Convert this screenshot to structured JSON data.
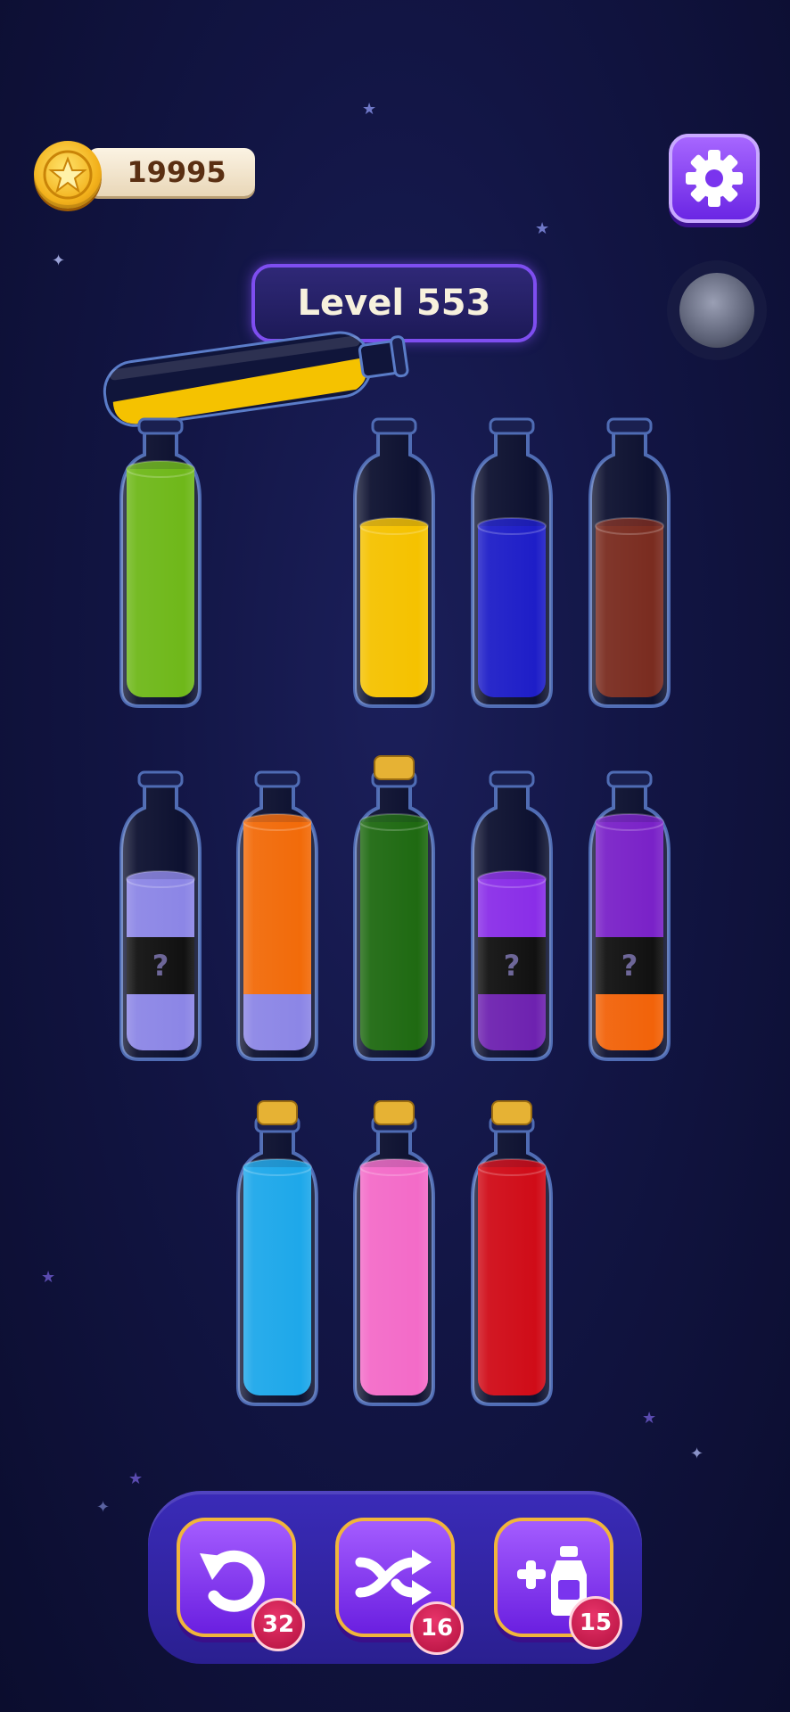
{
  "coins": {
    "value": "19995",
    "icon": "star-coin-icon"
  },
  "settings": {
    "icon": "gear-icon"
  },
  "level": {
    "label": "Level 553"
  },
  "hidden_mark": "?",
  "bottles": [
    {
      "id": "b1",
      "row": 1,
      "col": 0,
      "capped": false,
      "layers": [
        "#6fb81a",
        "#6fb81a",
        "#6fb81a",
        "#6fb81a"
      ],
      "hidden": [
        false,
        false,
        false,
        false
      ]
    },
    {
      "id": "b2",
      "row": 1,
      "col": 2,
      "capped": false,
      "layers": [
        "#f5c200",
        "#f5c200",
        "#f5c200"
      ],
      "hidden": [
        false,
        false,
        false
      ]
    },
    {
      "id": "b3",
      "row": 1,
      "col": 3,
      "capped": false,
      "layers": [
        "#1e1ec8",
        "#1e1ec8",
        "#1e1ec8"
      ],
      "hidden": [
        false,
        false,
        false
      ]
    },
    {
      "id": "b4",
      "row": 1,
      "col": 4,
      "capped": false,
      "layers": [
        "#7a2c20",
        "#7a2c20",
        "#7a2c20"
      ],
      "hidden": [
        false,
        false,
        false
      ]
    },
    {
      "id": "b5",
      "row": 2,
      "col": 0,
      "capped": false,
      "layers": [
        "#8c86e6",
        "#111111",
        "#8c86e6"
      ],
      "hidden": [
        false,
        true,
        false
      ]
    },
    {
      "id": "b6",
      "row": 2,
      "col": 1,
      "capped": false,
      "layers": [
        "#8c86e6",
        "#f26b0a",
        "#f26b0a",
        "#f26b0a"
      ],
      "hidden": [
        false,
        false,
        false,
        false
      ]
    },
    {
      "id": "b7",
      "row": 2,
      "col": 2,
      "capped": true,
      "layers": [
        "#1f6a12",
        "#1f6a12",
        "#1f6a12",
        "#1f6a12"
      ],
      "hidden": [
        false,
        false,
        false,
        false
      ]
    },
    {
      "id": "b8",
      "row": 2,
      "col": 3,
      "capped": false,
      "layers": [
        "#6e22b0",
        "#111111",
        "#8a2ee8"
      ],
      "hidden": [
        false,
        true,
        false
      ]
    },
    {
      "id": "b9",
      "row": 2,
      "col": 4,
      "capped": false,
      "layers": [
        "#f2630a",
        "#111111",
        "#7a22c8",
        "#7a22c8"
      ],
      "hidden": [
        false,
        true,
        false,
        false
      ]
    },
    {
      "id": "b10",
      "row": 3,
      "col": 1,
      "capped": true,
      "layers": [
        "#1ea8ea",
        "#1ea8ea",
        "#1ea8ea",
        "#1ea8ea"
      ],
      "hidden": [
        false,
        false,
        false,
        false
      ]
    },
    {
      "id": "b11",
      "row": 3,
      "col": 2,
      "capped": true,
      "layers": [
        "#f36bc8",
        "#f36bc8",
        "#f36bc8",
        "#f36bc8"
      ],
      "hidden": [
        false,
        false,
        false,
        false
      ]
    },
    {
      "id": "b12",
      "row": 3,
      "col": 3,
      "capped": true,
      "layers": [
        "#d00c18",
        "#d00c18",
        "#d00c18",
        "#d00c18"
      ],
      "hidden": [
        false,
        false,
        false,
        false
      ]
    }
  ],
  "pouring_bottle": {
    "color": "#f5c200"
  },
  "powerups": [
    {
      "name": "undo",
      "icon": "undo-icon",
      "count": "32"
    },
    {
      "name": "shuffle",
      "icon": "shuffle-icon",
      "count": "16"
    },
    {
      "name": "add-bottle",
      "icon": "add-bottle-icon",
      "count": "15"
    }
  ],
  "colors": {
    "accent": "#7e4ef0",
    "gold": "#f1b53b",
    "badge": "#c8174f"
  }
}
